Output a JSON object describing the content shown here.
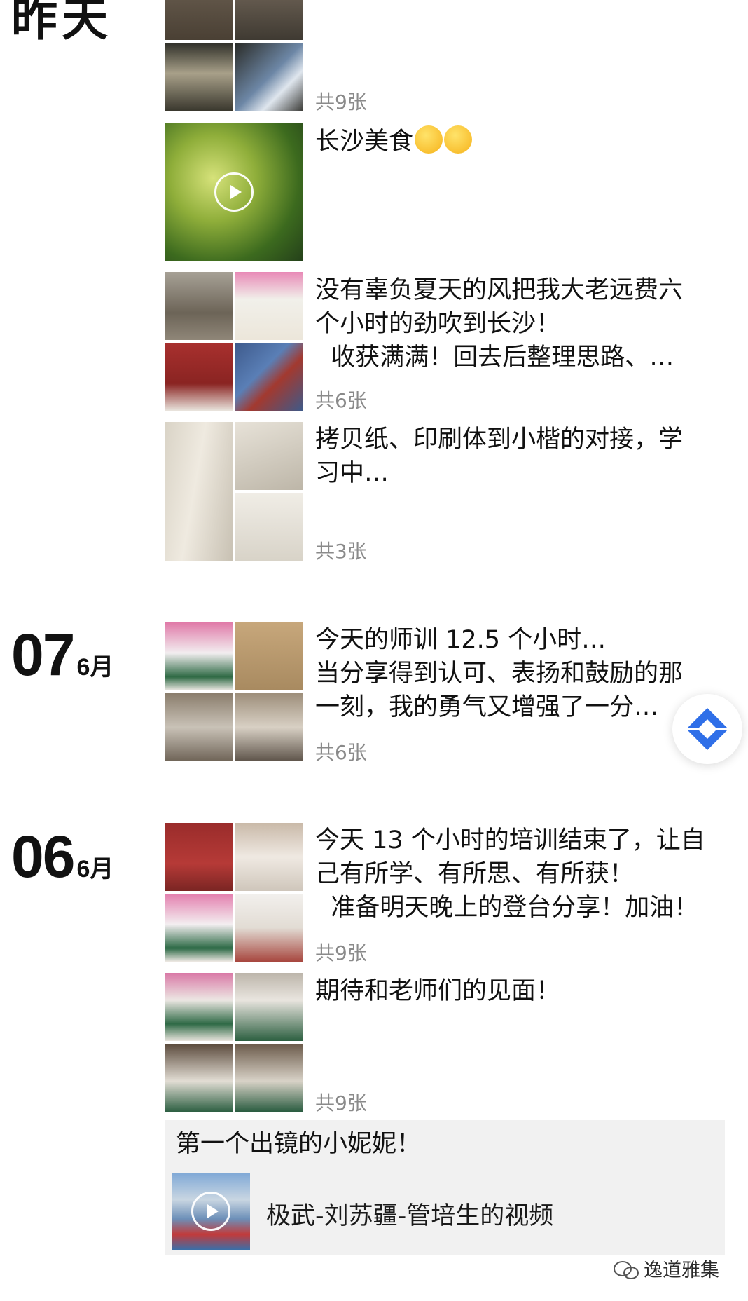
{
  "feed": {
    "header_yesterday": "昨天",
    "posts": [
      {
        "text": "",
        "count": "共9张"
      },
      {
        "text": "长沙美食",
        "count": ""
      },
      {
        "text": "没有辜负夏天的风把我大老远费六\n个小时的劲吹到长沙！\n  收获满满！回去后整理思路、…",
        "count": "共6张"
      },
      {
        "text": "拷贝纸、印刷体到小楷的对接，学\n习中…",
        "count": "共3张"
      },
      {
        "text": "今天的师训 12.5 个小时…\n当分享得到认可、表扬和鼓励的那\n一刻，我的勇气又增强了一分…",
        "count": "共6张"
      },
      {
        "text": "今天 13 个小时的培训结束了，让自\n己有所学、有所思、有所获！\n  准备明天晚上的登台分享！加油！",
        "count": "共9张"
      },
      {
        "text": "期待和老师们的见面！",
        "count": "共9张"
      }
    ],
    "date_07": {
      "day": "07",
      "month": "6月"
    },
    "date_06": {
      "day": "06",
      "month": "6月"
    },
    "share": {
      "title": "第一个出镜的小妮妮！",
      "label": "极武-刘苏疆-管培生的视频"
    }
  },
  "watermark": "逸道雅集",
  "colors": {
    "text": "#111111",
    "secondary": "#8a8a8a",
    "share_bg": "#f1f1f1",
    "float_icon": "#2f6fe8"
  }
}
